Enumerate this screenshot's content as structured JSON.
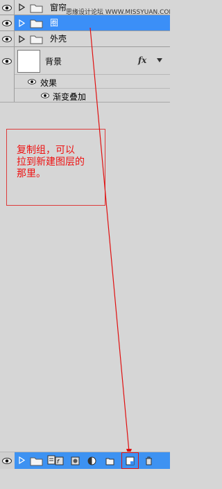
{
  "layers": [
    {
      "name": "窗帘",
      "type": "group",
      "selected": false
    },
    {
      "name": "圈",
      "type": "group",
      "selected": true
    },
    {
      "name": "外壳",
      "type": "group",
      "selected": false
    },
    {
      "name": "背景",
      "type": "layer",
      "selected": false
    }
  ],
  "watermark": "思缘设计论坛  WWW.MISSYUAN.COM",
  "effects": {
    "label": "效果",
    "items": [
      "渐变叠加"
    ]
  },
  "fx_label": "fx",
  "annotation": "复制组，可以\n拉到新建图层的\n那里。",
  "bottom_toolbar": {
    "tools": [
      "link-layers",
      "add-layer-style",
      "add-mask",
      "new-adjustment",
      "new-group",
      "new-layer",
      "delete-layer"
    ]
  },
  "colors": {
    "panel_bg": "#d6d6d6",
    "selection": "#3b8ff7",
    "annotation_red": "#dd3b3b"
  }
}
